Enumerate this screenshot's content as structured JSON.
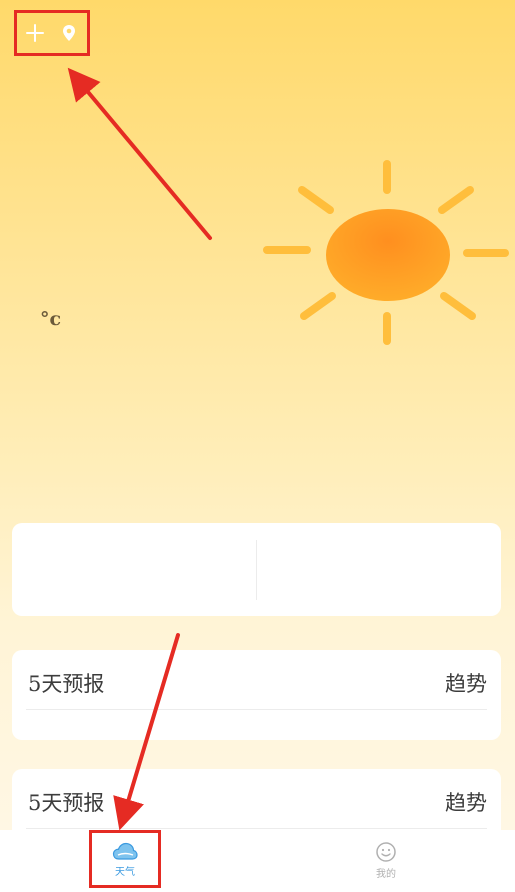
{
  "top_bar": {
    "add_icon": "plus-icon",
    "location_icon": "location-pin-icon"
  },
  "weather": {
    "condition_icon": "sun-icon",
    "temp_unit": "°c"
  },
  "forecast_cards": [
    {
      "title": "5天预报",
      "action": "趋势"
    },
    {
      "title": "5天预报",
      "action": "趋势"
    }
  ],
  "bottom_nav": {
    "items": [
      {
        "label": "天气",
        "icon": "cloud-icon",
        "active": true
      },
      {
        "label": "我的",
        "icon": "smiley-icon",
        "active": false
      }
    ]
  },
  "colors": {
    "annotation_red": "#e52b23",
    "active_tab": "#3b9ae0",
    "inactive_tab": "#b0b0b0",
    "sun_orange": "#ff9a1e",
    "sun_ray": "#ffbe3c"
  }
}
